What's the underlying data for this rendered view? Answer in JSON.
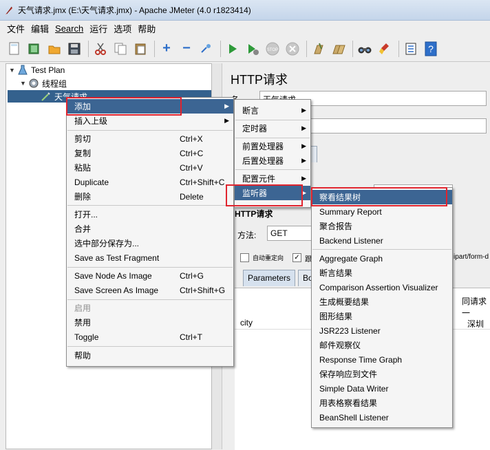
{
  "window": {
    "title": "天气请求.jmx (E:\\天气请求.jmx) - Apache JMeter (4.0 r1823414)"
  },
  "menubar": [
    "文件",
    "编辑",
    "Search",
    "运行",
    "选项",
    "帮助"
  ],
  "toolbar": {
    "icons": [
      "new-icon",
      "templates-icon",
      "open-icon",
      "save-icon",
      "cut-icon",
      "copy-icon",
      "paste-icon",
      "expand-icon",
      "collapse-icon",
      "toggle-icon",
      "start-icon",
      "start-no-pause-icon",
      "stop-icon",
      "shutdown-icon",
      "clear-icon",
      "clear-all-icon",
      "search-icon",
      "reset-search-icon",
      "function-helper-icon",
      "help-icon"
    ]
  },
  "tree": {
    "test_plan": "Test Plan",
    "thread_group": "线程组",
    "sampler": "天气请求"
  },
  "right_pane": {
    "title": "HTTP请求",
    "name_label": "名",
    "comment_label": "注",
    "name_value": "天气请求",
    "section_http": "HTTP请求",
    "method_label": "方法:",
    "method_value": "GET",
    "auto_redirect": "自动重定向",
    "follow_prefix": "跟",
    "multipart_suffix": "ipart/form-d",
    "tabs": [
      "Parameters",
      "Bo"
    ],
    "column_header": "同请求一",
    "param_name": "city",
    "param_value": "深圳"
  },
  "context_menu": {
    "items": [
      {
        "label": "添加",
        "submenu": true,
        "highlight": true
      },
      {
        "label": "插入上级",
        "submenu": true
      },
      {
        "separator": true
      },
      {
        "label": "剪切",
        "shortcut": "Ctrl+X"
      },
      {
        "label": "复制",
        "shortcut": "Ctrl+C"
      },
      {
        "label": "粘贴",
        "shortcut": "Ctrl+V"
      },
      {
        "label": "Duplicate",
        "shortcut": "Ctrl+Shift+C"
      },
      {
        "label": "删除",
        "shortcut": "Delete"
      },
      {
        "separator": true
      },
      {
        "label": "打开..."
      },
      {
        "label": "合并"
      },
      {
        "label": "选中部分保存为..."
      },
      {
        "label": "Save as Test Fragment"
      },
      {
        "separator": true
      },
      {
        "label": "Save Node As Image",
        "shortcut": "Ctrl+G"
      },
      {
        "label": "Save Screen As Image",
        "shortcut": "Ctrl+Shift+G"
      },
      {
        "separator": true
      },
      {
        "label": "启用",
        "disabled": true
      },
      {
        "label": "禁用"
      },
      {
        "label": "Toggle",
        "shortcut": "Ctrl+T"
      },
      {
        "separator": true
      },
      {
        "label": "帮助"
      }
    ]
  },
  "add_submenu": {
    "items": [
      {
        "label": "断言",
        "submenu": true
      },
      {
        "separator": true
      },
      {
        "label": "定时器",
        "submenu": true
      },
      {
        "separator": true
      },
      {
        "label": "前置处理器",
        "submenu": true
      },
      {
        "label": "后置处理器",
        "submenu": true
      },
      {
        "separator": true
      },
      {
        "label": "配置元件",
        "submenu": true
      },
      {
        "label": "监听器",
        "submenu": true,
        "highlight": true
      }
    ]
  },
  "listener_submenu": {
    "items": [
      {
        "label": "察看结果树",
        "highlight": true
      },
      {
        "label": "Summary Report"
      },
      {
        "label": "聚合报告"
      },
      {
        "label": "Backend Listener"
      },
      {
        "separator": true
      },
      {
        "label": "Aggregate Graph"
      },
      {
        "label": "断言结果"
      },
      {
        "label": "Comparison Assertion Visualizer"
      },
      {
        "label": "生成概要结果"
      },
      {
        "label": "图形结果"
      },
      {
        "label": "JSR223 Listener"
      },
      {
        "label": "邮件观察仪"
      },
      {
        "label": "Response Time Graph"
      },
      {
        "label": "保存响应到文件"
      },
      {
        "label": "Simple Data Writer"
      },
      {
        "label": "用表格察看结果"
      },
      {
        "label": "BeanShell Listener"
      }
    ]
  },
  "colors": {
    "highlight": "#3c6593",
    "tree_selected": "#34618d",
    "annotation_red": "#e0242e"
  }
}
